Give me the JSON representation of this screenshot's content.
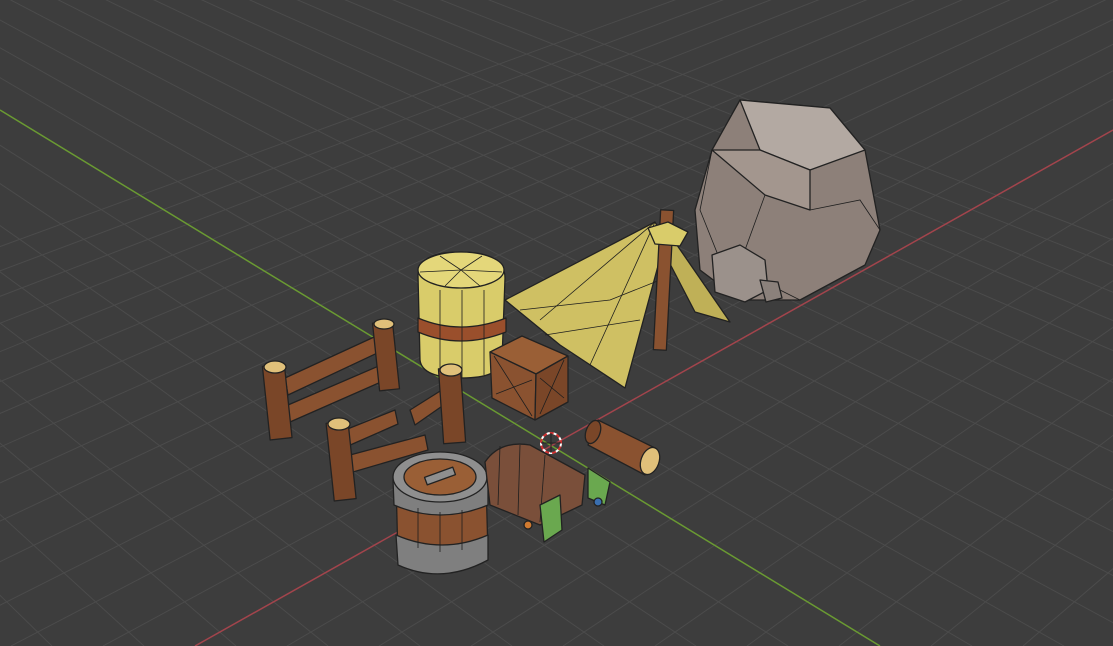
{
  "viewport": {
    "background": "#3d3d3d",
    "grid_color": "#4b4b4b",
    "x_axis_color": "#a2444c",
    "y_axis_color": "#6a9a32"
  },
  "palette": {
    "rock": "#8d8079",
    "rock_light": "#b3a9a2",
    "hay": "#d9cc6a",
    "tent": "#cfc063",
    "wood": "#8a5230",
    "wood_dark": "#6b3c22",
    "wood_end": "#e0c07a",
    "metal": "#7f7f7f"
  },
  "icons": {
    "cursor": "3d-cursor-icon"
  }
}
